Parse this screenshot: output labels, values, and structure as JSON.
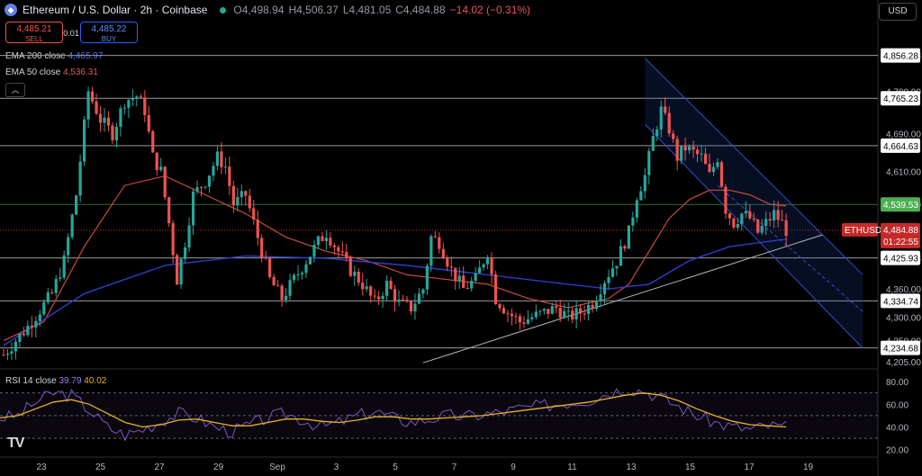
{
  "header": {
    "title": "Ethereum / U.S. Dollar · 2h · Coinbase",
    "open": "O4,498.94",
    "high": "H4,506.37",
    "low": "L4,481.05",
    "close": "C4,484.88",
    "change": "−14.02 (−0.31%)"
  },
  "trade": {
    "sell_price": "4,485.21",
    "sell_label": "SELL",
    "spread": "0.01",
    "buy_price": "4,485.22",
    "buy_label": "BUY"
  },
  "indicators": {
    "ema200_label": "EMA 200 close",
    "ema200_value": "4,465.97",
    "ema50_label": "EMA 50 close",
    "ema50_value": "4,536.31",
    "rsi_label": "RSI 14 close",
    "rsi_value": "39.79",
    "rsi_ma_value": "40.02"
  },
  "currency": "USD",
  "collapse_icon": "chevron-up-icon",
  "logo": "TV",
  "colors": {
    "background": "#000000",
    "up": "#26a69a",
    "down": "#ef5350",
    "ema50": "#c94a3f",
    "ema200": "#2f3cc9",
    "channel": "#2f4fbf",
    "rsi": "#7e57c2",
    "rsi_ma": "#e6b422",
    "green_label": "#4caf50",
    "ethusd_label": "#c62828"
  },
  "chart_data": {
    "type": "candlestick",
    "symbol": "ETHUSD",
    "timeframe": "2h",
    "price_axis": {
      "ticks": [
        4205,
        4250,
        4300,
        4360,
        4425.93,
        4540,
        4610,
        4690,
        4780,
        4856.28
      ],
      "labels": [
        "4,205.00",
        "4,250.00",
        "4,300.00",
        "4,360.00",
        "4,425.93",
        "4,540.00",
        "4,610.00",
        "4,690.00",
        "4,780.00",
        "4,856.28"
      ]
    },
    "levels": [
      {
        "value": 4856.28,
        "label": "4,856.28",
        "style": "white"
      },
      {
        "value": 4765.23,
        "label": "4,765.23",
        "style": "white"
      },
      {
        "value": 4664.63,
        "label": "4,664.63",
        "style": "white"
      },
      {
        "value": 4539.53,
        "label": "4,539.53",
        "style": "green"
      },
      {
        "value": 4425.93,
        "label": "4,425.93",
        "style": "white"
      },
      {
        "value": 4334.74,
        "label": "4,334.74",
        "style": "white"
      },
      {
        "value": 4234.68,
        "label": "4,234.68",
        "style": "white"
      }
    ],
    "current_price": {
      "value": 4484.88,
      "label": "4,484.88",
      "symbol": "ETHUSD",
      "countdown": "01:22:55"
    },
    "x_labels": [
      "23",
      "25",
      "27",
      "29",
      "Sep",
      "3",
      "5",
      "7",
      "9",
      "11",
      "13",
      "15",
      "17",
      "19"
    ],
    "price_path": [
      [
        0,
        4220
      ],
      [
        6,
        4280
      ],
      [
        12,
        4350
      ],
      [
        15,
        4420
      ],
      [
        18,
        4560
      ],
      [
        21,
        4780
      ],
      [
        24,
        4720
      ],
      [
        27,
        4690
      ],
      [
        30,
        4760
      ],
      [
        33,
        4770
      ],
      [
        35,
        4740
      ],
      [
        37,
        4640
      ],
      [
        39,
        4610
      ],
      [
        41,
        4500
      ],
      [
        43,
        4380
      ],
      [
        45,
        4460
      ],
      [
        47,
        4560
      ],
      [
        50,
        4590
      ],
      [
        53,
        4640
      ],
      [
        55,
        4620
      ],
      [
        57,
        4540
      ],
      [
        60,
        4560
      ],
      [
        63,
        4470
      ],
      [
        66,
        4380
      ],
      [
        69,
        4340
      ],
      [
        72,
        4380
      ],
      [
        75,
        4420
      ],
      [
        78,
        4460
      ],
      [
        80,
        4480
      ],
      [
        83,
        4440
      ],
      [
        86,
        4400
      ],
      [
        89,
        4370
      ],
      [
        92,
        4330
      ],
      [
        95,
        4370
      ],
      [
        98,
        4330
      ],
      [
        101,
        4320
      ],
      [
        104,
        4360
      ],
      [
        106,
        4470
      ],
      [
        108,
        4460
      ],
      [
        111,
        4400
      ],
      [
        114,
        4360
      ],
      [
        117,
        4380
      ],
      [
        120,
        4440
      ],
      [
        122,
        4340
      ],
      [
        125,
        4310
      ],
      [
        128,
        4290
      ],
      [
        131,
        4300
      ],
      [
        134,
        4310
      ],
      [
        137,
        4320
      ],
      [
        140,
        4300
      ],
      [
        143,
        4310
      ],
      [
        146,
        4330
      ],
      [
        149,
        4380
      ],
      [
        152,
        4420
      ],
      [
        155,
        4480
      ],
      [
        157,
        4560
      ],
      [
        159,
        4600
      ],
      [
        161,
        4680
      ],
      [
        163,
        4740
      ],
      [
        165,
        4700
      ],
      [
        167,
        4640
      ],
      [
        169,
        4660
      ],
      [
        171,
        4650
      ],
      [
        173,
        4640
      ],
      [
        175,
        4600
      ],
      [
        177,
        4640
      ],
      [
        179,
        4530
      ],
      [
        181,
        4500
      ],
      [
        183,
        4520
      ],
      [
        185,
        4510
      ],
      [
        187,
        4480
      ],
      [
        189,
        4500
      ],
      [
        191,
        4520
      ],
      [
        193,
        4500
      ],
      [
        194,
        4484.88
      ]
    ],
    "ema50_path": [
      [
        0,
        4250
      ],
      [
        10,
        4290
      ],
      [
        20,
        4450
      ],
      [
        30,
        4580
      ],
      [
        40,
        4600
      ],
      [
        50,
        4560
      ],
      [
        60,
        4520
      ],
      [
        70,
        4470
      ],
      [
        80,
        4440
      ],
      [
        90,
        4420
      ],
      [
        100,
        4390
      ],
      [
        110,
        4380
      ],
      [
        120,
        4370
      ],
      [
        130,
        4340
      ],
      [
        140,
        4320
      ],
      [
        150,
        4340
      ],
      [
        155,
        4370
      ],
      [
        160,
        4440
      ],
      [
        165,
        4510
      ],
      [
        170,
        4550
      ],
      [
        175,
        4570
      ],
      [
        180,
        4570
      ],
      [
        185,
        4560
      ],
      [
        190,
        4540
      ],
      [
        194,
        4536.31
      ]
    ],
    "ema200_path": [
      [
        0,
        4240
      ],
      [
        20,
        4350
      ],
      [
        40,
        4410
      ],
      [
        60,
        4430
      ],
      [
        80,
        4425
      ],
      [
        100,
        4410
      ],
      [
        120,
        4390
      ],
      [
        140,
        4370
      ],
      [
        150,
        4360
      ],
      [
        160,
        4370
      ],
      [
        170,
        4420
      ],
      [
        180,
        4450
      ],
      [
        194,
        4465.97
      ]
    ],
    "rsi_axis": {
      "ticks": [
        20,
        40,
        60,
        80
      ],
      "labels": [
        "20.00",
        "40.00",
        "60.00",
        "80.00"
      ],
      "bands": [
        30,
        50,
        70
      ]
    },
    "rsi_values": [
      48,
      50,
      62,
      70,
      68,
      55,
      40,
      33,
      38,
      45,
      52,
      48,
      40,
      36,
      42,
      48,
      52,
      46,
      40,
      44,
      50,
      54,
      48,
      44,
      47,
      50,
      49,
      51,
      53,
      56,
      58,
      60,
      62,
      64,
      70,
      74,
      72,
      66,
      58,
      50,
      44,
      40,
      38,
      41,
      40
    ],
    "rsi_ma_values": [
      48,
      50,
      56,
      62,
      64,
      60,
      52,
      44,
      40,
      42,
      46,
      47,
      44,
      41,
      41,
      44,
      47,
      47,
      45,
      44,
      46,
      49,
      49,
      47,
      47,
      48,
      49,
      50,
      52,
      54,
      56,
      58,
      60,
      62,
      65,
      68,
      70,
      68,
      63,
      56,
      50,
      45,
      42,
      41,
      40
    ]
  }
}
